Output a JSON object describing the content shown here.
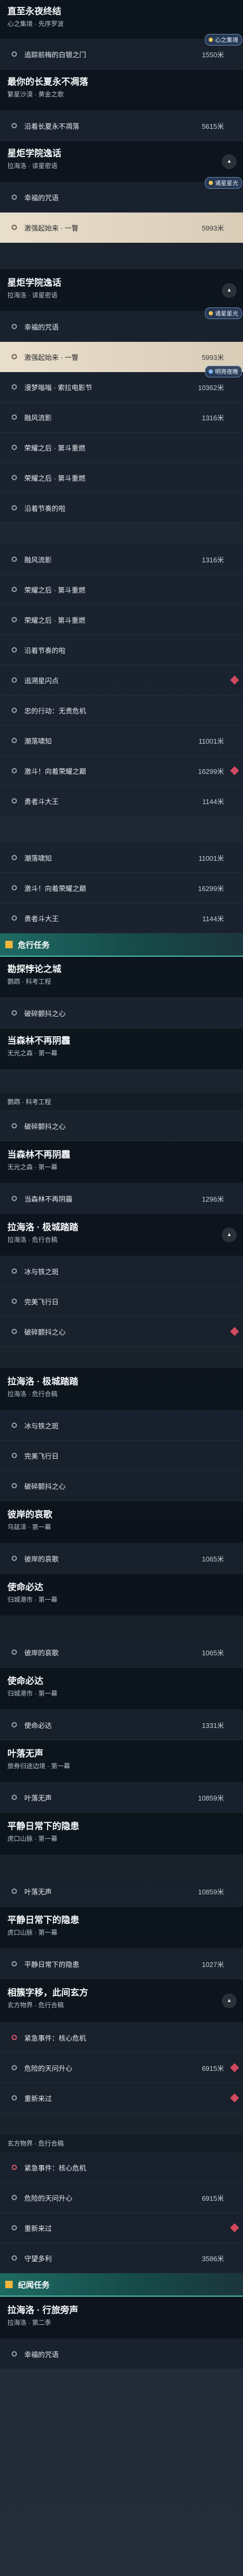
{
  "icons": {
    "chevron_up": "▲",
    "location": "location-ring-icon",
    "marker": "quest-marker-icon"
  },
  "colors": {
    "accent_teal": "#4dc5b0",
    "marker_red": "#d24a5f",
    "section_square": "#f2b63d"
  },
  "tags": {
    "heart_song": "心之集境",
    "starlight": "诸星星光",
    "bright_night": "明亮夜晚"
  },
  "quests": {
    "q_forever_night": {
      "title": "直至永夜终结",
      "subtitle": "心之集境 · 先序罗波"
    },
    "q_long_summer": {
      "title": "最你的长夏永不凋落",
      "subtitle": "繁星沙漠 · 黄金之歌"
    },
    "q_academy": {
      "title": "星炬学院逸话",
      "subtitle": "拉海洛 · 读星密语"
    },
    "q_hidden_world": {
      "title": "勘探悖论之城",
      "subtitle": "鹦鹉 · 科考工程"
    },
    "q_forest": {
      "title": "当森林不再阴霾",
      "subtitle": "无光之森 · 第一幕"
    },
    "q_lahailuo_star": {
      "title": "拉海洛 · 极城踏踏",
      "subtitle": "拉海洛 · 危行合稿"
    },
    "q_lahailuo_safe": {
      "title": "拉海洛 · 危行合稿",
      "subtitle": ""
    },
    "q_pirate": {
      "title": "彼岸的哀歌",
      "subtitle": "乌兹泽 · 第一幕"
    },
    "q_mission": {
      "title": "使命必达",
      "subtitle": "归城港市 · 第一幕"
    },
    "q_night": {
      "title": "叶落无声",
      "subtitle": "旅券归途边境 · 第一幕"
    },
    "q_quiet": {
      "title": "平静日常下的隐患",
      "subtitle": "虎口山脉 · 第一幕"
    },
    "q_universe": {
      "title": "相簇字移，此间玄方",
      "subtitle": "玄方物界 · 危行合稿"
    },
    "q_lahailuo_sound": {
      "title": "拉海洛 · 行旅旁声",
      "subtitle": "拉海洛 · 第二季"
    }
  },
  "subtasks": {
    "pursue_gate": "追踪前梅的白银之门",
    "long_summer_blossom": "沿着长夏永不凋落",
    "star_secret": "幸福的咒语",
    "excel_return": "激强起始来 · 一瞥",
    "neon_dream": "漫梦嗡嗡 · 索拉电影节",
    "breath_alive": "融风流影",
    "glory_two": "荣耀之后 · 第斗重燃",
    "along_memory": "沿着节奏的啦",
    "hidden_light": "追溯星闪点",
    "self_guard": "忠的行动：无责危机",
    "cold_flow": "潮落啸知",
    "excited_forward": "激斗！向着荣耀之巅",
    "brave_king": "勇者斗大王",
    "forest_edge": "当森林不再阴霾",
    "ice_and_heart": "冰与铁之斑",
    "fly_fly": "完美飞行日",
    "happy_heart": "破碎颤抖之心",
    "pirate_cry": "彼岸的哀歌",
    "mission_call": "使命必达",
    "leaf_silent": "叶落无声",
    "quiet_danger": "平静日常下的隐患",
    "new_heart": "紧急事件：核心危机",
    "wild_heart": "危险的天问升心",
    "guarded": "守望多利",
    "reload": "重新来过"
  },
  "distances": {
    "d_1550": "1550米",
    "d_5615": "5615米",
    "d_5993": "5993米",
    "d_10362": "10362米",
    "d_1316": "1316米",
    "d_11001": "11001米",
    "d_16299": "16299米",
    "d_1144": "1144米",
    "d_1296": "1296米",
    "d_1065": "1065米",
    "d_1331": "1331米",
    "d_10859": "10859米",
    "d_1027": "1027米",
    "d_6915": "6915米",
    "d_3586": "3586米"
  },
  "sections": {
    "side": "危行任务",
    "chronicle": "纪闻任务"
  },
  "subheads": {
    "hidden_city": "鹦鹉 · 科考工程",
    "lahailuo_safe": "拉海洛 · 危行合稿",
    "universe_line": "玄方物界 · 危行合稿",
    "universe_top": "玄方物界 · 危行合稿"
  }
}
